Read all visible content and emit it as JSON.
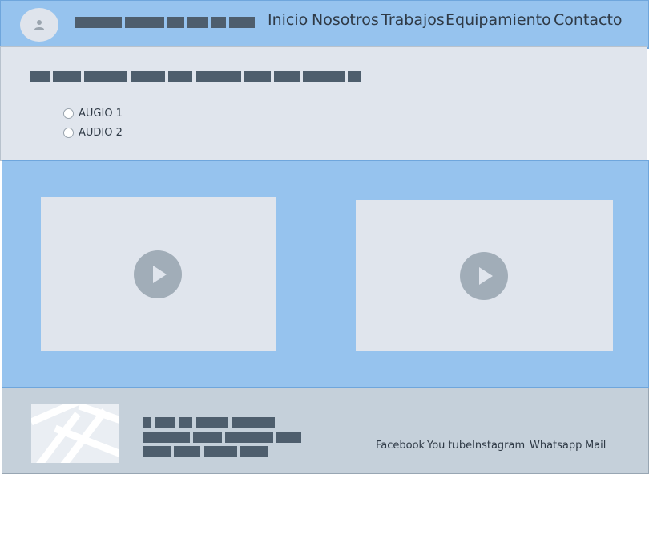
{
  "header": {
    "nav": [
      "Inicio",
      "Nosotros",
      "Trabajos",
      "Equipamiento",
      "Contacto"
    ]
  },
  "audio": {
    "options": [
      "AUGIO 1",
      "AUDIO 2"
    ]
  },
  "videos": [
    {
      "icon": "play-icon"
    },
    {
      "icon": "play-icon"
    }
  ],
  "footer": {
    "social": [
      "Facebook",
      "You tube",
      "Instagram",
      "Whatsapp",
      "Mail"
    ]
  },
  "colors": {
    "header_bg": "#96c3ee",
    "section_bg": "#e0e5ed",
    "footer_bg": "#c5d0da",
    "placeholder_text": "#4e5e6d",
    "play_button": "#a1adb8"
  }
}
